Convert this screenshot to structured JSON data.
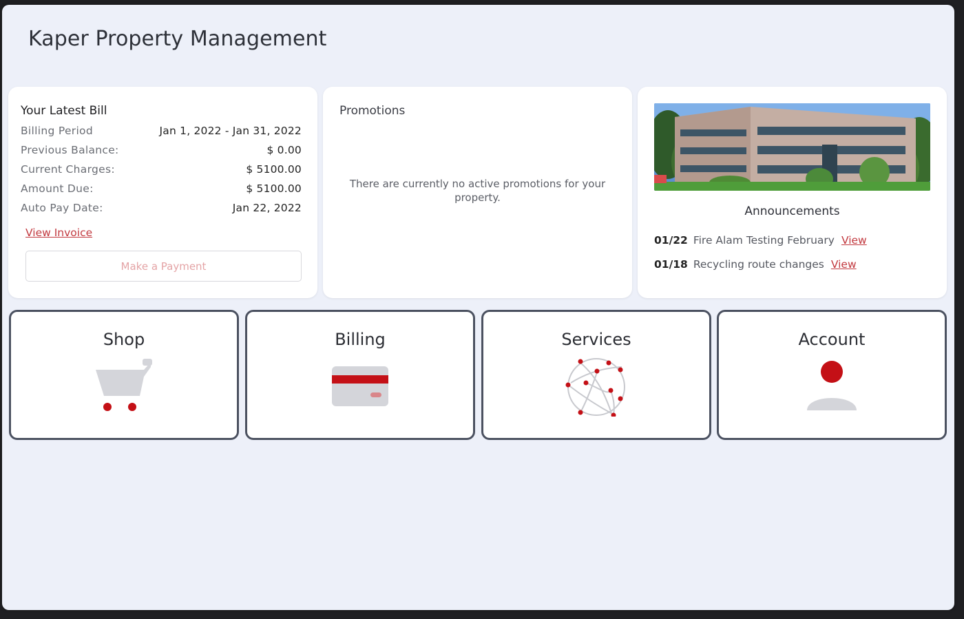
{
  "header": {
    "title": "Kaper Property Management"
  },
  "bill": {
    "title": "Your Latest Bill",
    "rows": [
      {
        "label": "Billing Period",
        "value": "Jan 1, 2022 - Jan 31, 2022"
      },
      {
        "label": "Previous Balance:",
        "value": "$ 0.00"
      },
      {
        "label": "Current Charges:",
        "value": "$ 5100.00"
      },
      {
        "label": "Amount Due:",
        "value": "$ 5100.00"
      },
      {
        "label": "Auto Pay Date:",
        "value": "Jan 22, 2022"
      }
    ],
    "view_invoice": "View Invoice",
    "pay_button": "Make a Payment"
  },
  "promotions": {
    "title": "Promotions",
    "empty_message": "There are currently no active promotions for your property."
  },
  "announcements": {
    "title": "Announcements",
    "items": [
      {
        "date": "01/22",
        "text": "Fire Alam Testing February",
        "link": "View"
      },
      {
        "date": "01/18",
        "text": "Recycling route changes",
        "link": "View"
      }
    ]
  },
  "tiles": [
    {
      "label": "Shop",
      "icon": "shopping-cart-icon"
    },
    {
      "label": "Billing",
      "icon": "credit-card-icon"
    },
    {
      "label": "Services",
      "icon": "network-globe-icon"
    },
    {
      "label": "Account",
      "icon": "user-profile-icon"
    }
  ],
  "colors": {
    "accent": "#c41016",
    "background": "#edf0f9",
    "icon_gray": "#d4d5da"
  }
}
